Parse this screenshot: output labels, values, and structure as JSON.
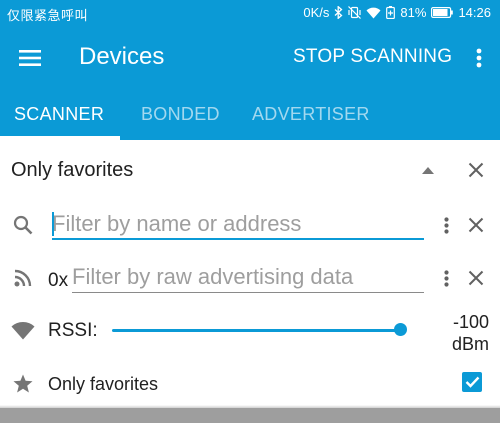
{
  "status_bar": {
    "carrier": "仅限紧急呼叫",
    "speed": "0K/s",
    "battery": "81%",
    "time": "14:26"
  },
  "app_bar": {
    "title": "Devices",
    "action": "STOP SCANNING",
    "icons": [
      "menu-icon",
      "more-vert-icon"
    ]
  },
  "tabs": [
    {
      "label": "SCANNER",
      "active": true
    },
    {
      "label": "BONDED",
      "active": false
    },
    {
      "label": "ADVERTISER",
      "active": false
    }
  ],
  "filter_panel": {
    "title": "Only favorites",
    "name_filter": {
      "placeholder": "Filter by name or address",
      "value": ""
    },
    "raw_filter": {
      "prefix": "0x",
      "placeholder": "Filter by raw advertising data",
      "value": ""
    },
    "rssi": {
      "label": "RSSI:",
      "value_line1": "-100",
      "value_line2": "dBm",
      "slider_fraction": 1.0
    },
    "favorites": {
      "label": "Only favorites",
      "checked": true
    }
  },
  "colors": {
    "primary": "#0b9ad6",
    "text": "#212121",
    "icon_grey": "#757575",
    "hint": "#9e9e9e"
  }
}
